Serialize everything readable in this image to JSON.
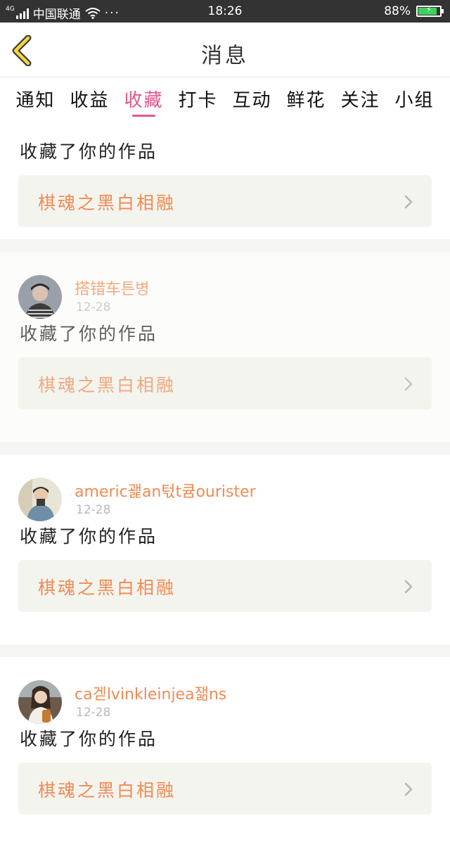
{
  "status_bar": {
    "network_type": "4G",
    "carrier": "中国联通",
    "more": "···",
    "time": "18:26",
    "battery_percent_text": "88%",
    "battery_level": 0.88
  },
  "nav": {
    "title": "消息"
  },
  "tabs": [
    {
      "label": "通知",
      "active": false
    },
    {
      "label": "收益",
      "active": false
    },
    {
      "label": "收藏",
      "active": true
    },
    {
      "label": "打卡",
      "active": false
    },
    {
      "label": "互动",
      "active": false
    },
    {
      "label": "鲜花",
      "active": false
    },
    {
      "label": "关注",
      "active": false
    },
    {
      "label": "小组",
      "active": false
    }
  ],
  "messages": [
    {
      "message": "收藏了你的作品",
      "work": "棋魂之黑白相融"
    },
    {
      "user": "搭错车튼병",
      "date": "12-28",
      "message": "收藏了你的作品",
      "work": "棋魂之黑白相融"
    },
    {
      "user": "americ괥an턳t큠ourister",
      "date": "12-28",
      "message": "收藏了你的作品",
      "work": "棋魂之黑白相融"
    },
    {
      "user": "ca겓lvinkleinjea잶ns",
      "date": "12-28",
      "message": "收藏了你的作品",
      "work": "棋魂之黑白相融"
    }
  ],
  "colors": {
    "accent": "#e7558b",
    "name_orange": "#f08a54",
    "work_box_bg": "#f4f4ee",
    "back_icon_yellow": "#f5d63d"
  }
}
